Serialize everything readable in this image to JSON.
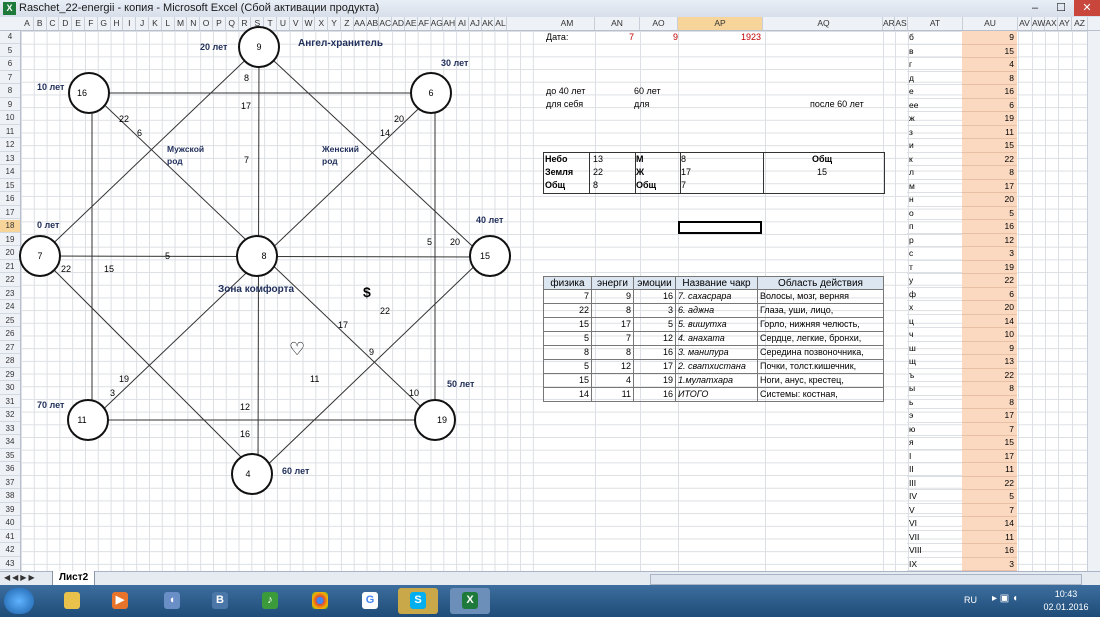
{
  "window": {
    "title": "Raschet_22-energii - копия - Microsoft Excel (Сбой активации продукта)",
    "excel_icon": "X"
  },
  "columns": [
    "A",
    "B",
    "C",
    "D",
    "E",
    "F",
    "G",
    "H",
    "I",
    "J",
    "K",
    "L",
    "M",
    "N",
    "O",
    "P",
    "Q",
    "R",
    "S",
    "T",
    "U",
    "V",
    "W",
    "X",
    "Y",
    "Z",
    "AA",
    "AB",
    "AC",
    "AD",
    "AE",
    "AF",
    "AG",
    "AH",
    "AI",
    "AJ",
    "AK",
    "AL"
  ],
  "right_columns": [
    "AM",
    "AN",
    "AO",
    "AP",
    "AQ",
    "AR",
    "AS",
    "AT",
    "AU",
    "AV",
    "AW",
    "AX",
    "AY",
    "AZ"
  ],
  "rows": [
    "4",
    "5",
    "6",
    "7",
    "8",
    "9",
    "10",
    "11",
    "12",
    "13",
    "14",
    "15",
    "16",
    "17",
    "18",
    "19",
    "20",
    "21",
    "22",
    "23",
    "24",
    "25",
    "26",
    "27",
    "28",
    "29",
    "30",
    "31",
    "32",
    "33",
    "34",
    "35",
    "36",
    "37",
    "38",
    "39",
    "40",
    "41",
    "42",
    "43"
  ],
  "diagram": {
    "nodes": [
      {
        "label": "9"
      },
      {
        "label": "16"
      },
      {
        "label": "6"
      },
      {
        "label": "7"
      },
      {
        "label": "8"
      },
      {
        "label": "15"
      },
      {
        "label": "11"
      },
      {
        "label": "19"
      },
      {
        "label": "4"
      }
    ],
    "ages": [
      "20 лет",
      "10 лет",
      "30 лет",
      "0 лет",
      "40 лет",
      "70 лет",
      "50 лет",
      "60 лет"
    ],
    "title_top": "Ангел-хранитель",
    "male": "Мужской род",
    "female": "Женский род",
    "comfort": "Зона комфорта",
    "dollar": "$",
    "heart": "♡",
    "line_labels": [
      "8",
      "17",
      "7",
      "22",
      "6",
      "14",
      "20",
      "5",
      "5",
      "20",
      "22",
      "15",
      "17",
      "22",
      "9",
      "11",
      "19",
      "3",
      "12",
      "16",
      "10"
    ]
  },
  "info": {
    "date_label": "Дата:",
    "day": "7",
    "month": "9",
    "year": "1923",
    "before40": "до 40 лет",
    "for_self": "для себя",
    "age60": "60 лет",
    "for_other": "для",
    "after60": "после 60 лет"
  },
  "sums": {
    "nebo": "Небо",
    "nebo_v": "13",
    "m": "М",
    "m_v": "8",
    "obsh": "Общ",
    "zemlya": "Земля",
    "zemlya_v": "22",
    "zh": "Ж",
    "zh_v": "17",
    "obsh_v2": "15",
    "obsh1": "Общ",
    "obsh1_v": "8",
    "obsh2": "Общ",
    "obsh2_v": "7"
  },
  "chakra": {
    "headers": [
      "физика",
      "энерги",
      "эмоции",
      "Название чакр",
      "Область действия"
    ],
    "rows": [
      [
        "7",
        "9",
        "16",
        "7. сахасрара",
        "Волосы, мозг, верняя"
      ],
      [
        "22",
        "8",
        "3",
        "6. аджна",
        "Глаза, уши, лицо,"
      ],
      [
        "15",
        "17",
        "5",
        "5. вишутха",
        "Горло, нижняя челюсть,"
      ],
      [
        "5",
        "7",
        "12",
        "4. анахата",
        "Сердце, легкие, бронхи,"
      ],
      [
        "8",
        "8",
        "16",
        "3. манипура",
        "Середина позвоночника,"
      ],
      [
        "5",
        "12",
        "17",
        "2. сватхистана",
        "Почки, толст.кишечник,"
      ],
      [
        "15",
        "4",
        "19",
        "1.мулатхара",
        "Ноги, анус, крестец,"
      ],
      [
        "14",
        "11",
        "16",
        "ИТОГО",
        "Системы: костная,"
      ]
    ]
  },
  "letters": [
    [
      "б",
      "9"
    ],
    [
      "в",
      "15"
    ],
    [
      "г",
      "4"
    ],
    [
      "д",
      "8"
    ],
    [
      "е",
      "16"
    ],
    [
      "ее",
      "6"
    ],
    [
      "ж",
      "19"
    ],
    [
      "з",
      "11"
    ],
    [
      "и",
      "15"
    ],
    [
      "к",
      "22"
    ],
    [
      "л",
      "8"
    ],
    [
      "м",
      "17"
    ],
    [
      "н",
      "20"
    ],
    [
      "о",
      "5"
    ],
    [
      "п",
      "16"
    ],
    [
      "р",
      "12"
    ],
    [
      "с",
      "3"
    ],
    [
      "т",
      "19"
    ],
    [
      "у",
      "22"
    ],
    [
      "ф",
      "6"
    ],
    [
      "х",
      "20"
    ],
    [
      "ц",
      "14"
    ],
    [
      "ч",
      "10"
    ],
    [
      "ш",
      "9"
    ],
    [
      "щ",
      "13"
    ],
    [
      "ъ",
      "22"
    ],
    [
      "ы",
      "8"
    ],
    [
      "ь",
      "8"
    ],
    [
      "э",
      "17"
    ],
    [
      "ю",
      "7"
    ],
    [
      "я",
      "15"
    ],
    [
      "I",
      "17"
    ],
    [
      "II",
      "11"
    ],
    [
      "III",
      "22"
    ],
    [
      "IV",
      "5"
    ],
    [
      "V",
      "7"
    ],
    [
      "VI",
      "14"
    ],
    [
      "VII",
      "11"
    ],
    [
      "VIII",
      "16"
    ],
    [
      "IX",
      "3"
    ]
  ],
  "sheet_tab": "Лист2",
  "taskbar": {
    "lang": "RU",
    "time": "10:43",
    "date": "02.01.2016"
  },
  "colors": {
    "accent": "#f7d59a",
    "peach": "#fbd9c0",
    "header_blue": "#dce6f1"
  }
}
